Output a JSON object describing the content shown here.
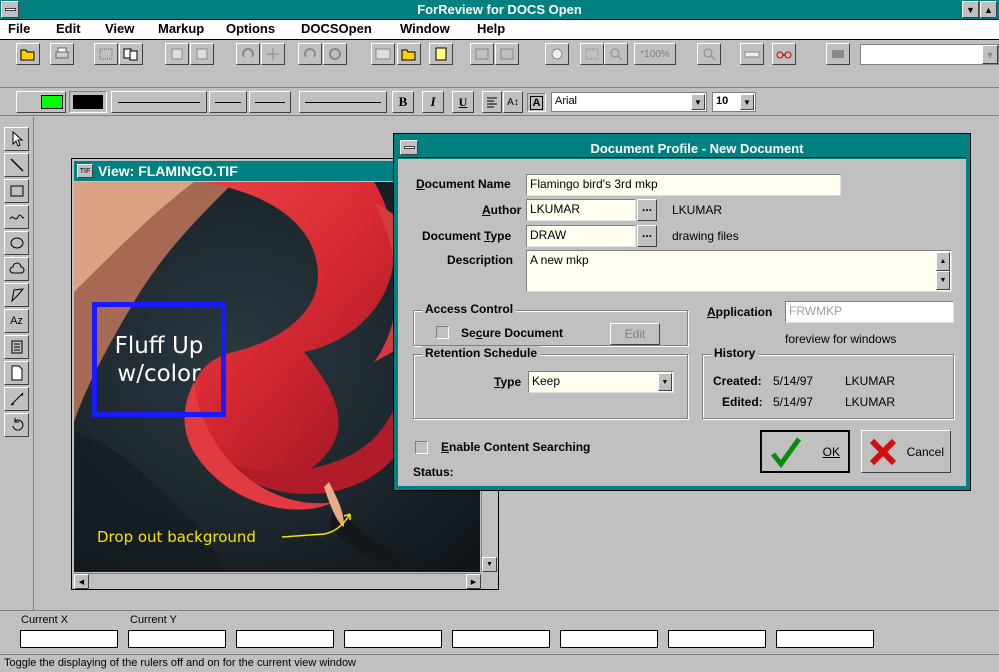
{
  "app": {
    "title": "ForReview for DOCS Open"
  },
  "menu": [
    "File",
    "Edit",
    "View",
    "Markup",
    "Options",
    "DOCSOpen",
    "Window",
    "Help"
  ],
  "toolbar": {
    "zoom_label": "*100%"
  },
  "format_bar": {
    "bold": "B",
    "italic": "I",
    "underline": "U",
    "font": "Arial",
    "size": "10"
  },
  "view": {
    "title": "View: FLAMINGO.TIF",
    "annotation_box_text": "Fluff Up\nw/color",
    "annotation_line1": "Fluff Up",
    "annotation_line2": "w/color",
    "annotation_arrow_text": "Drop out background"
  },
  "dialog": {
    "title": "Document Profile - New Document",
    "doc_name_label": "Document Name",
    "doc_name_value": "Flamingo bird's 3rd mkp",
    "author_label": "Author",
    "author_value": "LKUMAR",
    "author_full": "LKUMAR",
    "doc_type_label": "Document Type",
    "doc_type_value": "DRAW",
    "doc_type_desc": "drawing files",
    "description_label": "Description",
    "description_value": "A new mkp",
    "browse": "...",
    "access_title": "Access Control",
    "secure_label": "Secure Document",
    "edit_button": "Edit",
    "application_label": "Application",
    "application_value": "FRWMKP",
    "application_desc": "foreview for windows",
    "retention_title": "Retention Schedule",
    "type_label": "Type",
    "type_value": "Keep",
    "history_title": "History",
    "created_label": "Created:",
    "created_date": "5/14/97",
    "created_by": "LKUMAR",
    "edited_label": "Edited:",
    "edited_date": "5/14/97",
    "edited_by": "LKUMAR",
    "content_search_label": "Enable Content Searching",
    "status_label": "Status:",
    "ok_button": "OK",
    "cancel_button": "Cancel"
  },
  "statusbar": {
    "current_x": "Current X",
    "current_y": "Current Y",
    "help_text": "Toggle the displaying of the rulers off and on for the current view window"
  },
  "colors": {
    "title_bg": "#008080",
    "dialog_title_bg": "#008080",
    "annotation_blue": "#1a1aff",
    "annotation_yellow": "#f4e400",
    "flamingo": "#e0303a"
  }
}
